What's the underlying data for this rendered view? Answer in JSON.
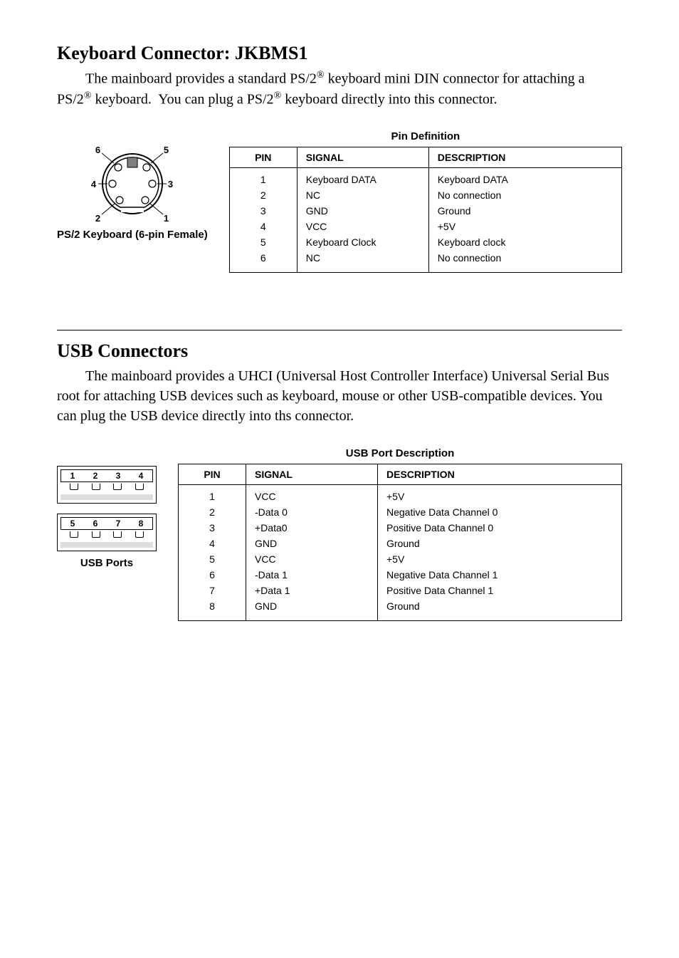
{
  "section1": {
    "title": "Keyboard Connector: JKBMS1",
    "body": "The mainboard provides a standard PS/2® keyboard mini DIN connector for attaching a PS/2® keyboard.  You can plug a PS/2® keyboard directly into this connector.",
    "figure_caption": "PS/2 Keyboard (6-pin Female)",
    "table_title": "Pin Definition",
    "headers": {
      "pin": "PIN",
      "signal": "SIGNAL",
      "description": "DESCRIPTION"
    },
    "rows": [
      {
        "pin": "1",
        "signal": "Keyboard DATA",
        "description": "Keyboard DATA"
      },
      {
        "pin": "2",
        "signal": "NC",
        "description": "No connection"
      },
      {
        "pin": "3",
        "signal": "GND",
        "description": "Ground"
      },
      {
        "pin": "4",
        "signal": "VCC",
        "description": "+5V"
      },
      {
        "pin": "5",
        "signal": "Keyboard Clock",
        "description": "Keyboard clock"
      },
      {
        "pin": "6",
        "signal": "NC",
        "description": "No connection"
      }
    ],
    "pin_labels": {
      "1": "1",
      "2": "2",
      "3": "3",
      "4": "4",
      "5": "5",
      "6": "6"
    }
  },
  "section2": {
    "title": "USB Connectors",
    "body": "The mainboard provides a UHCI (Universal Host Controller Interface) Universal Serial Bus root for attaching USB devices such as keyboard, mouse or other USB-compatible devices.  You can plug the USB device directly into ths connector.",
    "figure_caption": "USB Ports",
    "table_title": "USB Port Description",
    "headers": {
      "pin": "PIN",
      "signal": "SIGNAL",
      "description": "DESCRIPTION"
    },
    "rows": [
      {
        "pin": "1",
        "signal": "VCC",
        "description": "+5V"
      },
      {
        "pin": "2",
        "signal": "-Data 0",
        "description": "Negative Data Channel 0"
      },
      {
        "pin": "3",
        "signal": "+Data0",
        "description": "Positive Data Channel 0"
      },
      {
        "pin": "4",
        "signal": "GND",
        "description": "Ground"
      },
      {
        "pin": "5",
        "signal": "VCC",
        "description": "+5V"
      },
      {
        "pin": "6",
        "signal": "-Data 1",
        "description": "Negative Data Channel 1"
      },
      {
        "pin": "7",
        "signal": "+Data 1",
        "description": "Positive Data Channel 1"
      },
      {
        "pin": "8",
        "signal": "GND",
        "description": "Ground"
      }
    ],
    "port_labels": {
      "top": [
        "1",
        "2",
        "3",
        "4"
      ],
      "bottom": [
        "5",
        "6",
        "7",
        "8"
      ]
    }
  }
}
